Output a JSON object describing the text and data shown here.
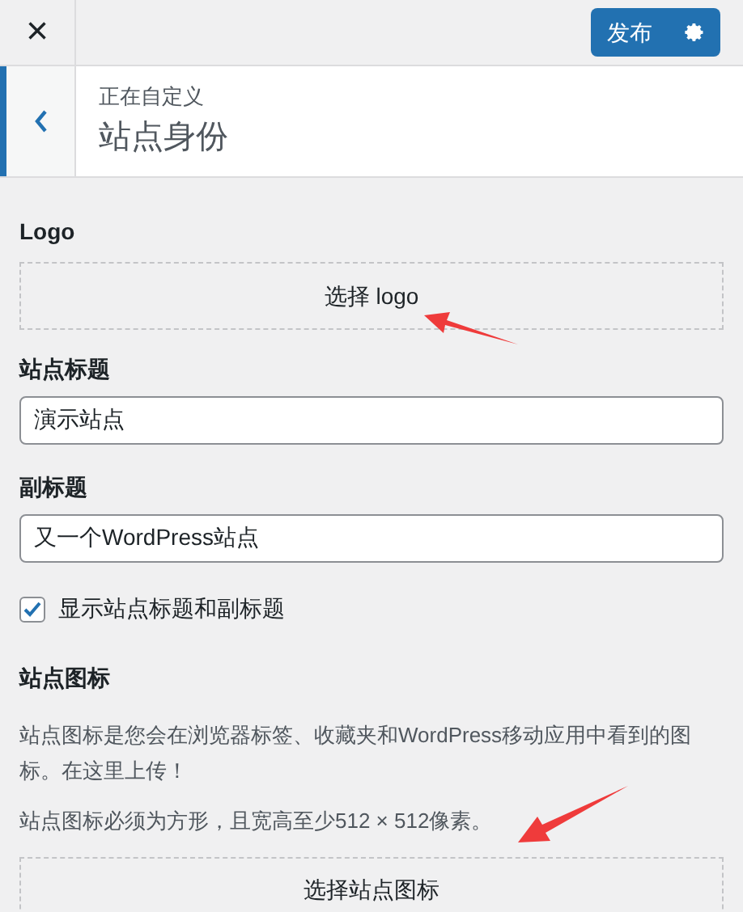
{
  "header": {
    "close": "×",
    "publish": "发布"
  },
  "section": {
    "breadcrumb": "正在自定义",
    "title": "站点身份"
  },
  "logo": {
    "label": "Logo",
    "button": "选择 logo"
  },
  "site_title": {
    "label": "站点标题",
    "value": "演示站点"
  },
  "tagline": {
    "label": "副标题",
    "value": "又一个WordPress站点"
  },
  "show_title": {
    "label": "显示站点标题和副标题",
    "checked": true
  },
  "site_icon": {
    "label": "站点图标",
    "description": "站点图标是您会在浏览器标签、收藏夹和WordPress移动应用中看到的图标。在这里上传！",
    "note": "站点图标必须为方形，且宽高至少512 × 512像素。",
    "button": "选择站点图标"
  }
}
